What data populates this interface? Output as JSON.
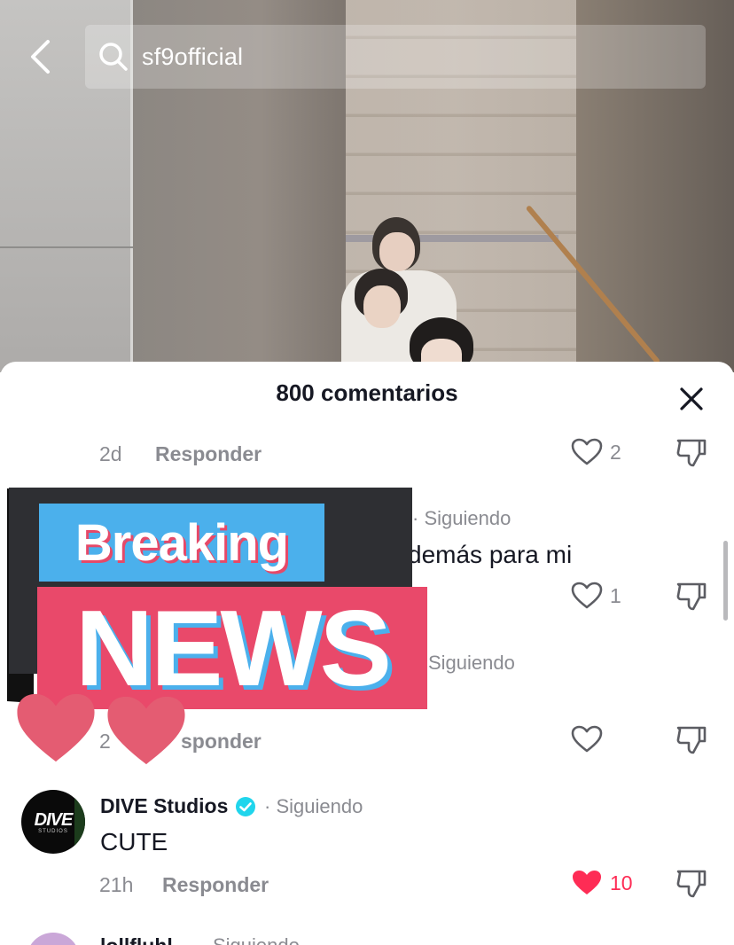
{
  "search": {
    "query": "sf9official"
  },
  "sheet": {
    "title": "800 comentarios"
  },
  "comments": [
    {
      "time": "2d",
      "reply_label": "Responder",
      "likes": "2"
    },
    {
      "following_label": "Siguiendo",
      "text_fragment": "demás para mi",
      "likes": "1"
    },
    {
      "following_label": "Siguiendo",
      "time": "2",
      "reply_label": "sponder"
    },
    {
      "username": "DIVE Studios",
      "verified": true,
      "following_label": "Siguiendo",
      "text": "CUTE",
      "time": "21h",
      "reply_label": "Responder",
      "likes": "10",
      "liked": true,
      "avatar": {
        "main": "DIVE",
        "sub": "STUDIOS"
      }
    },
    {
      "username": "lollfluhl...",
      "following_label": "Siguiendo"
    }
  ],
  "sticker": {
    "top_text": "Breaking",
    "main_text": "NEWS"
  },
  "colors": {
    "accent_red": "#fe2c55",
    "verified_blue": "#20d5ec",
    "sticker_blue": "#4bb0ec",
    "sticker_pink": "#e9496a"
  },
  "icons": [
    "back-arrow-icon",
    "search-icon",
    "close-icon",
    "heart-outline-icon",
    "heart-filled-icon",
    "dislike-icon",
    "verified-icon",
    "heart-sticker-icon"
  ]
}
